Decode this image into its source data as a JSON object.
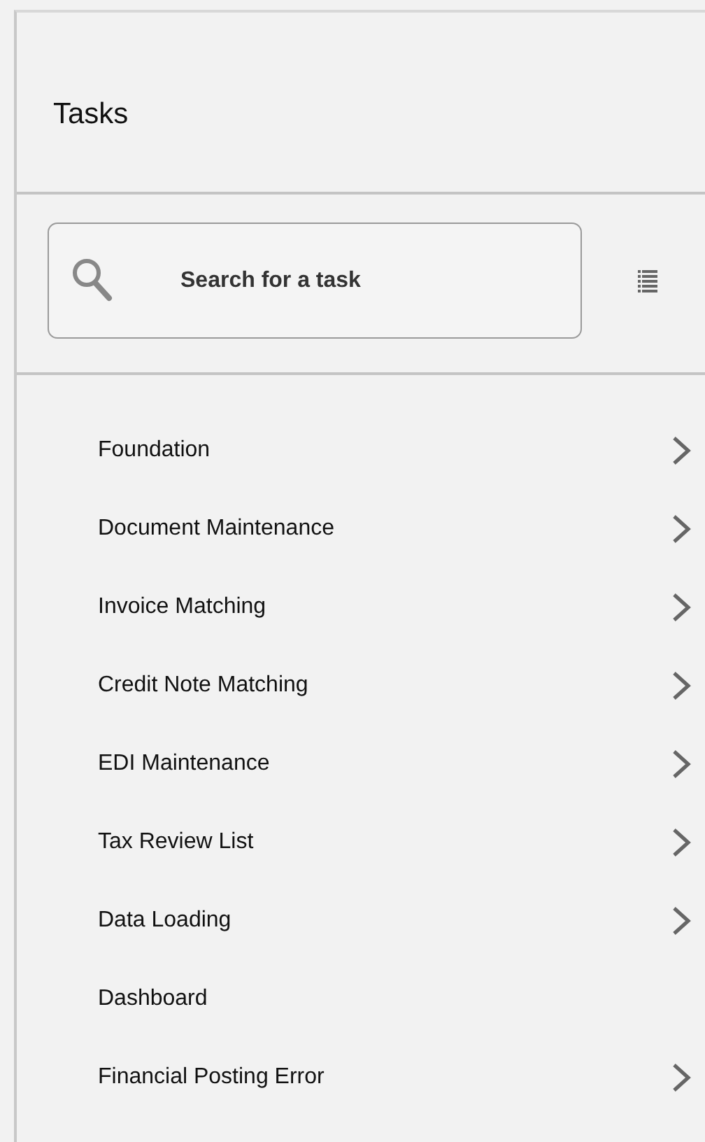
{
  "panel": {
    "title": "Tasks"
  },
  "search": {
    "placeholder": "Search for a task"
  },
  "tasks": [
    {
      "label": "Foundation",
      "expandable": true
    },
    {
      "label": "Document Maintenance",
      "expandable": true
    },
    {
      "label": "Invoice Matching",
      "expandable": true
    },
    {
      "label": "Credit Note Matching",
      "expandable": true
    },
    {
      "label": "EDI Maintenance",
      "expandable": true
    },
    {
      "label": "Tax Review List",
      "expandable": true
    },
    {
      "label": "Data Loading",
      "expandable": true
    },
    {
      "label": "Dashboard",
      "expandable": false
    },
    {
      "label": "Financial Posting Error",
      "expandable": true
    }
  ]
}
